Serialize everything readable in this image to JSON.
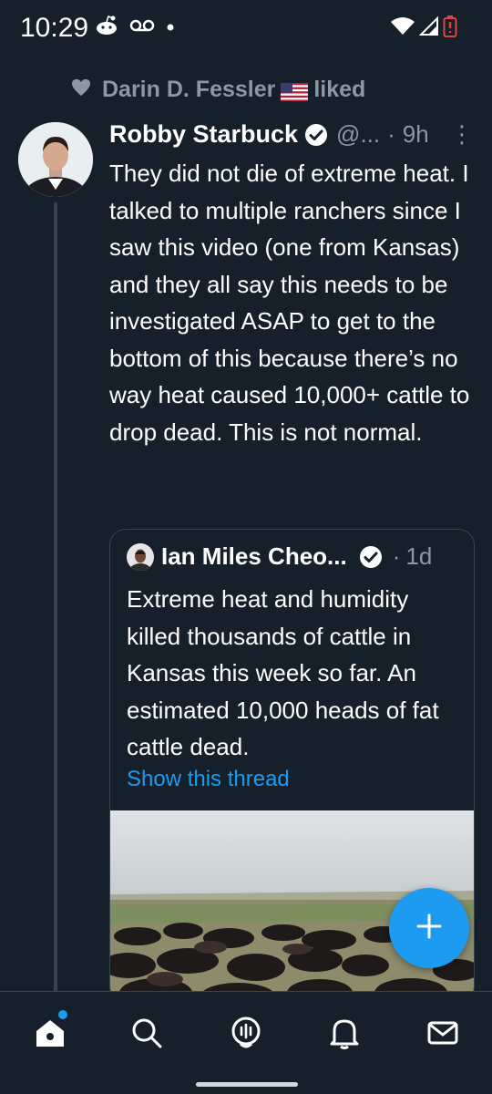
{
  "status_bar": {
    "time": "10:29",
    "left_icons": [
      "reddit-icon",
      "voicemail-icon",
      "dot-icon"
    ],
    "right_icons": [
      "wifi-icon",
      "signal-icon",
      "battery-low-icon"
    ]
  },
  "social_context": {
    "icon": "heart-icon",
    "user": "Darin D. Fessler",
    "flag": "us-flag-icon",
    "action": "liked"
  },
  "tweet": {
    "author_name": "Robby Starbuck",
    "handle": "@...",
    "separator": "·",
    "time": "9h",
    "more": "⋮",
    "text": "They did not die of extreme heat. I talked to multiple ranchers since I saw this video (one from Kansas) and they all say this needs to be investigated ASAP to get to the bottom of this because there’s no way heat caused 10,000+ cattle to drop dead. This is not normal."
  },
  "quote": {
    "author_name": "Ian Miles Cheo...",
    "separator": "·",
    "time": "1d",
    "text": "Extreme heat and humidity killed thousands of cattle in Kansas this week so far. An estimated 10,000 heads of fat cattle dead.",
    "show_thread": "Show this thread"
  },
  "colors": {
    "background": "#15202b",
    "accent": "#1d9bf0",
    "muted": "#8b98a5",
    "border": "#38444d"
  },
  "bottom_nav": [
    "home-icon",
    "search-icon",
    "spaces-icon",
    "notifications-icon",
    "messages-icon"
  ]
}
